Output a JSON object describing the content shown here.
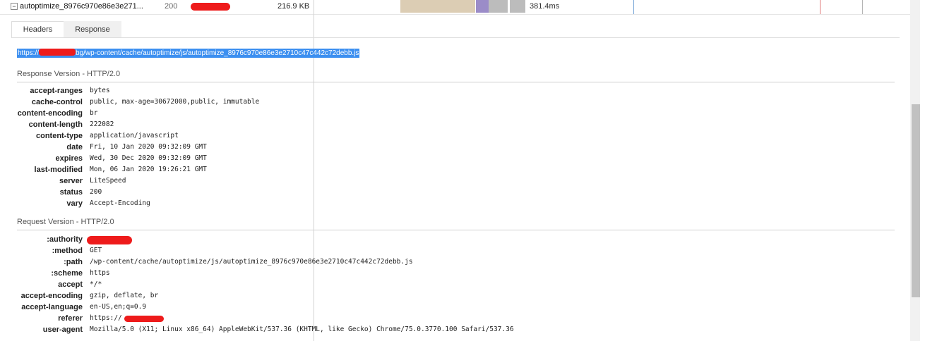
{
  "request": {
    "toggle": "−",
    "name": "autoptimize_8976c970e86e3e271...",
    "status": "200",
    "size": "216.9 KB",
    "time": "381.4ms"
  },
  "tabs": [
    {
      "label": "Headers",
      "active": true
    },
    {
      "label": "Response",
      "active": false
    }
  ],
  "url": {
    "prefix": "https://",
    "suffix": "bg/wp-content/cache/autoptimize/js/autoptimize_8976c970e86e3e2710c47c442c72debb.js"
  },
  "response_section": {
    "title": "Response Version - HTTP/2.0",
    "headers": [
      {
        "key": "accept-ranges",
        "value": "bytes"
      },
      {
        "key": "cache-control",
        "value": "public, max-age=30672000,public, immutable"
      },
      {
        "key": "content-encoding",
        "value": "br"
      },
      {
        "key": "content-length",
        "value": "222082"
      },
      {
        "key": "content-type",
        "value": "application/javascript"
      },
      {
        "key": "date",
        "value": "Fri, 10 Jan 2020 09:32:09 GMT"
      },
      {
        "key": "expires",
        "value": "Wed, 30 Dec 2020 09:32:09 GMT"
      },
      {
        "key": "last-modified",
        "value": "Mon, 06 Jan 2020 19:26:21 GMT"
      },
      {
        "key": "server",
        "value": "LiteSpeed"
      },
      {
        "key": "status",
        "value": "200"
      },
      {
        "key": "vary",
        "value": "Accept-Encoding"
      }
    ]
  },
  "request_section": {
    "title": "Request Version - HTTP/2.0",
    "headers": [
      {
        "key": ":authority",
        "value": ""
      },
      {
        "key": ":method",
        "value": "GET"
      },
      {
        "key": ":path",
        "value": "/wp-content/cache/autoptimize/js/autoptimize_8976c970e86e3e2710c47c442c72debb.js"
      },
      {
        "key": ":scheme",
        "value": "https"
      },
      {
        "key": "accept",
        "value": "*/*"
      },
      {
        "key": "accept-encoding",
        "value": "gzip, deflate, br"
      },
      {
        "key": "accept-language",
        "value": "en-US,en;q=0.9"
      },
      {
        "key": "referer",
        "value": "https://"
      },
      {
        "key": "user-agent",
        "value": "Mozilla/5.0 (X11; Linux x86_64) AppleWebKit/537.36 (KHTML, like Gecko) Chrome/75.0.3770.100 Safari/537.36"
      }
    ]
  },
  "colors": {
    "selection": "#3c8ff0",
    "redaction": "#ee1b1b",
    "waterfall_wait": "#dccdb4",
    "waterfall_connect": "#9b8cc8",
    "waterfall_ssl": "#bcbcbc"
  }
}
